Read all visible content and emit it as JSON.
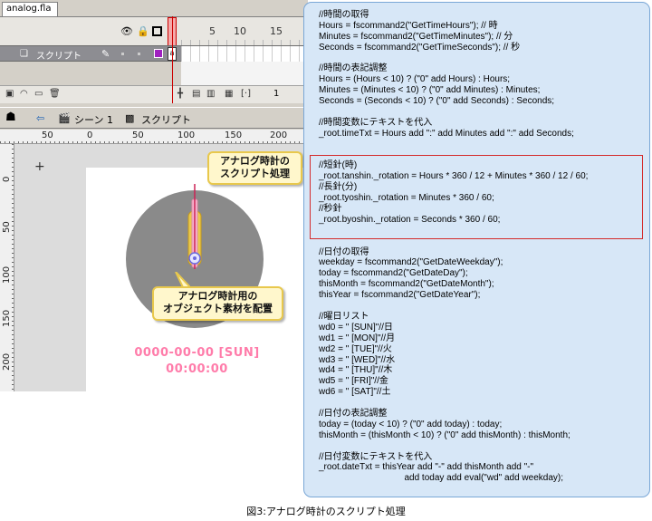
{
  "document_tab": "analog.fla",
  "timeline": {
    "frame_numbers": [
      "5",
      "10",
      "15"
    ],
    "layer_name": "スクリプト",
    "keyframe_mark": "a",
    "current_frame": "1"
  },
  "edit_bar": {
    "back_icon": "back-arrow-icon",
    "scene_label": "シーン 1",
    "symbol_label": "スクリプト"
  },
  "rulers": {
    "top": [
      "50",
      "0",
      "50",
      "100",
      "150",
      "200"
    ],
    "left": [
      "0",
      "50",
      "100",
      "150",
      "200"
    ]
  },
  "stage": {
    "date_text": "0000-00-00 [SUN]",
    "time_text": "00:00:00"
  },
  "callouts": {
    "script_line1": "アナログ時計の",
    "script_line2": "スクリプト処理",
    "material_line1": "アナログ時計用の",
    "material_line2": "オブジェクト素材を配置"
  },
  "colors": {
    "clock_face": "#8a8a8a",
    "text_pink": "#ff7caa",
    "panel_bg": "#d7e7f7",
    "highlight": "#d42a2a"
  },
  "code": {
    "block1": [
      "//時間の取得",
      "Hours = fscommand2(\"GetTimeHours\"); // 時",
      "Minutes = fscommand2(\"GetTimeMinutes\"); // 分",
      "Seconds = fscommand2(\"GetTimeSeconds\"); // 秒"
    ],
    "block2": [
      "//時間の表記調整",
      "Hours = (Hours < 10) ? (\"0\" add Hours) : Hours;",
      "Minutes = (Minutes < 10) ? (\"0\" add Minutes) : Minutes;",
      "Seconds = (Seconds < 10) ? (\"0\" add Seconds) : Seconds;"
    ],
    "block3": [
      "//時間変数にテキストを代入",
      "_root.timeTxt = Hours add \":\" add Minutes add \":\" add Seconds;"
    ],
    "block4": [
      "//短針(時)",
      "_root.tanshin._rotation = Hours * 360 / 12 + Minutes * 360 / 12 / 60;",
      "//長針(分)",
      "_root.tyoshin._rotation = Minutes * 360 / 60;",
      "//秒針",
      "_root.byoshin._rotation = Seconds * 360 / 60;"
    ],
    "block5": [
      "//日付の取得",
      "weekday = fscommand2(\"GetDateWeekday\");",
      "today = fscommand2(\"GetDateDay\");",
      "thisMonth = fscommand2(\"GetDateMonth\");",
      "thisYear = fscommand2(\"GetDateYear\");"
    ],
    "block6": [
      "//曜日リスト",
      "wd0 = \" [SUN]\"//日",
      "wd1 = \" [MON]\"//月",
      "wd2 = \" [TUE]\"//火",
      "wd3 = \" [WED]\"//水",
      "wd4 = \" [THU]\"//木",
      "wd5 = \" [FRI]\"//金",
      "wd6 = \" [SAT]\"//土"
    ],
    "block7": [
      "//日付の表記調整",
      "today = (today < 10) ? (\"0\" add today) : today;",
      "thisMonth = (thisMonth < 10) ? (\"0\" add thisMonth) : thisMonth;"
    ],
    "block8": [
      "//日付変数にテキストを代入",
      "_root.dateTxt = thisYear add \"-\" add thisMonth add \"-\"",
      "                                  add today add eval(\"wd\" add weekday);"
    ]
  },
  "caption": "図3:アナログ時計のスクリプト処理"
}
